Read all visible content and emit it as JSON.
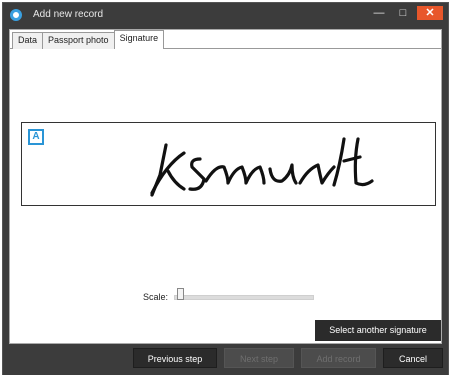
{
  "window": {
    "title": "Add new record",
    "minimize_glyph": "—",
    "maximize_glyph": "□",
    "close_glyph": "✕"
  },
  "tabs": [
    {
      "label": "Data"
    },
    {
      "label": "Passport photo"
    },
    {
      "label": "Signature"
    }
  ],
  "signature": {
    "badge": "A"
  },
  "scale": {
    "label": "Scale:",
    "value_fraction": 0.02
  },
  "actions": {
    "select_signature_label": "Select another signature"
  },
  "footer": {
    "previous_label": "Previous step",
    "next_label": "Next step",
    "add_label": "Add record",
    "cancel_label": "Cancel"
  },
  "colors": {
    "accent": "#2a95d6",
    "close": "#e8572b",
    "chrome": "#3c3c3c"
  }
}
